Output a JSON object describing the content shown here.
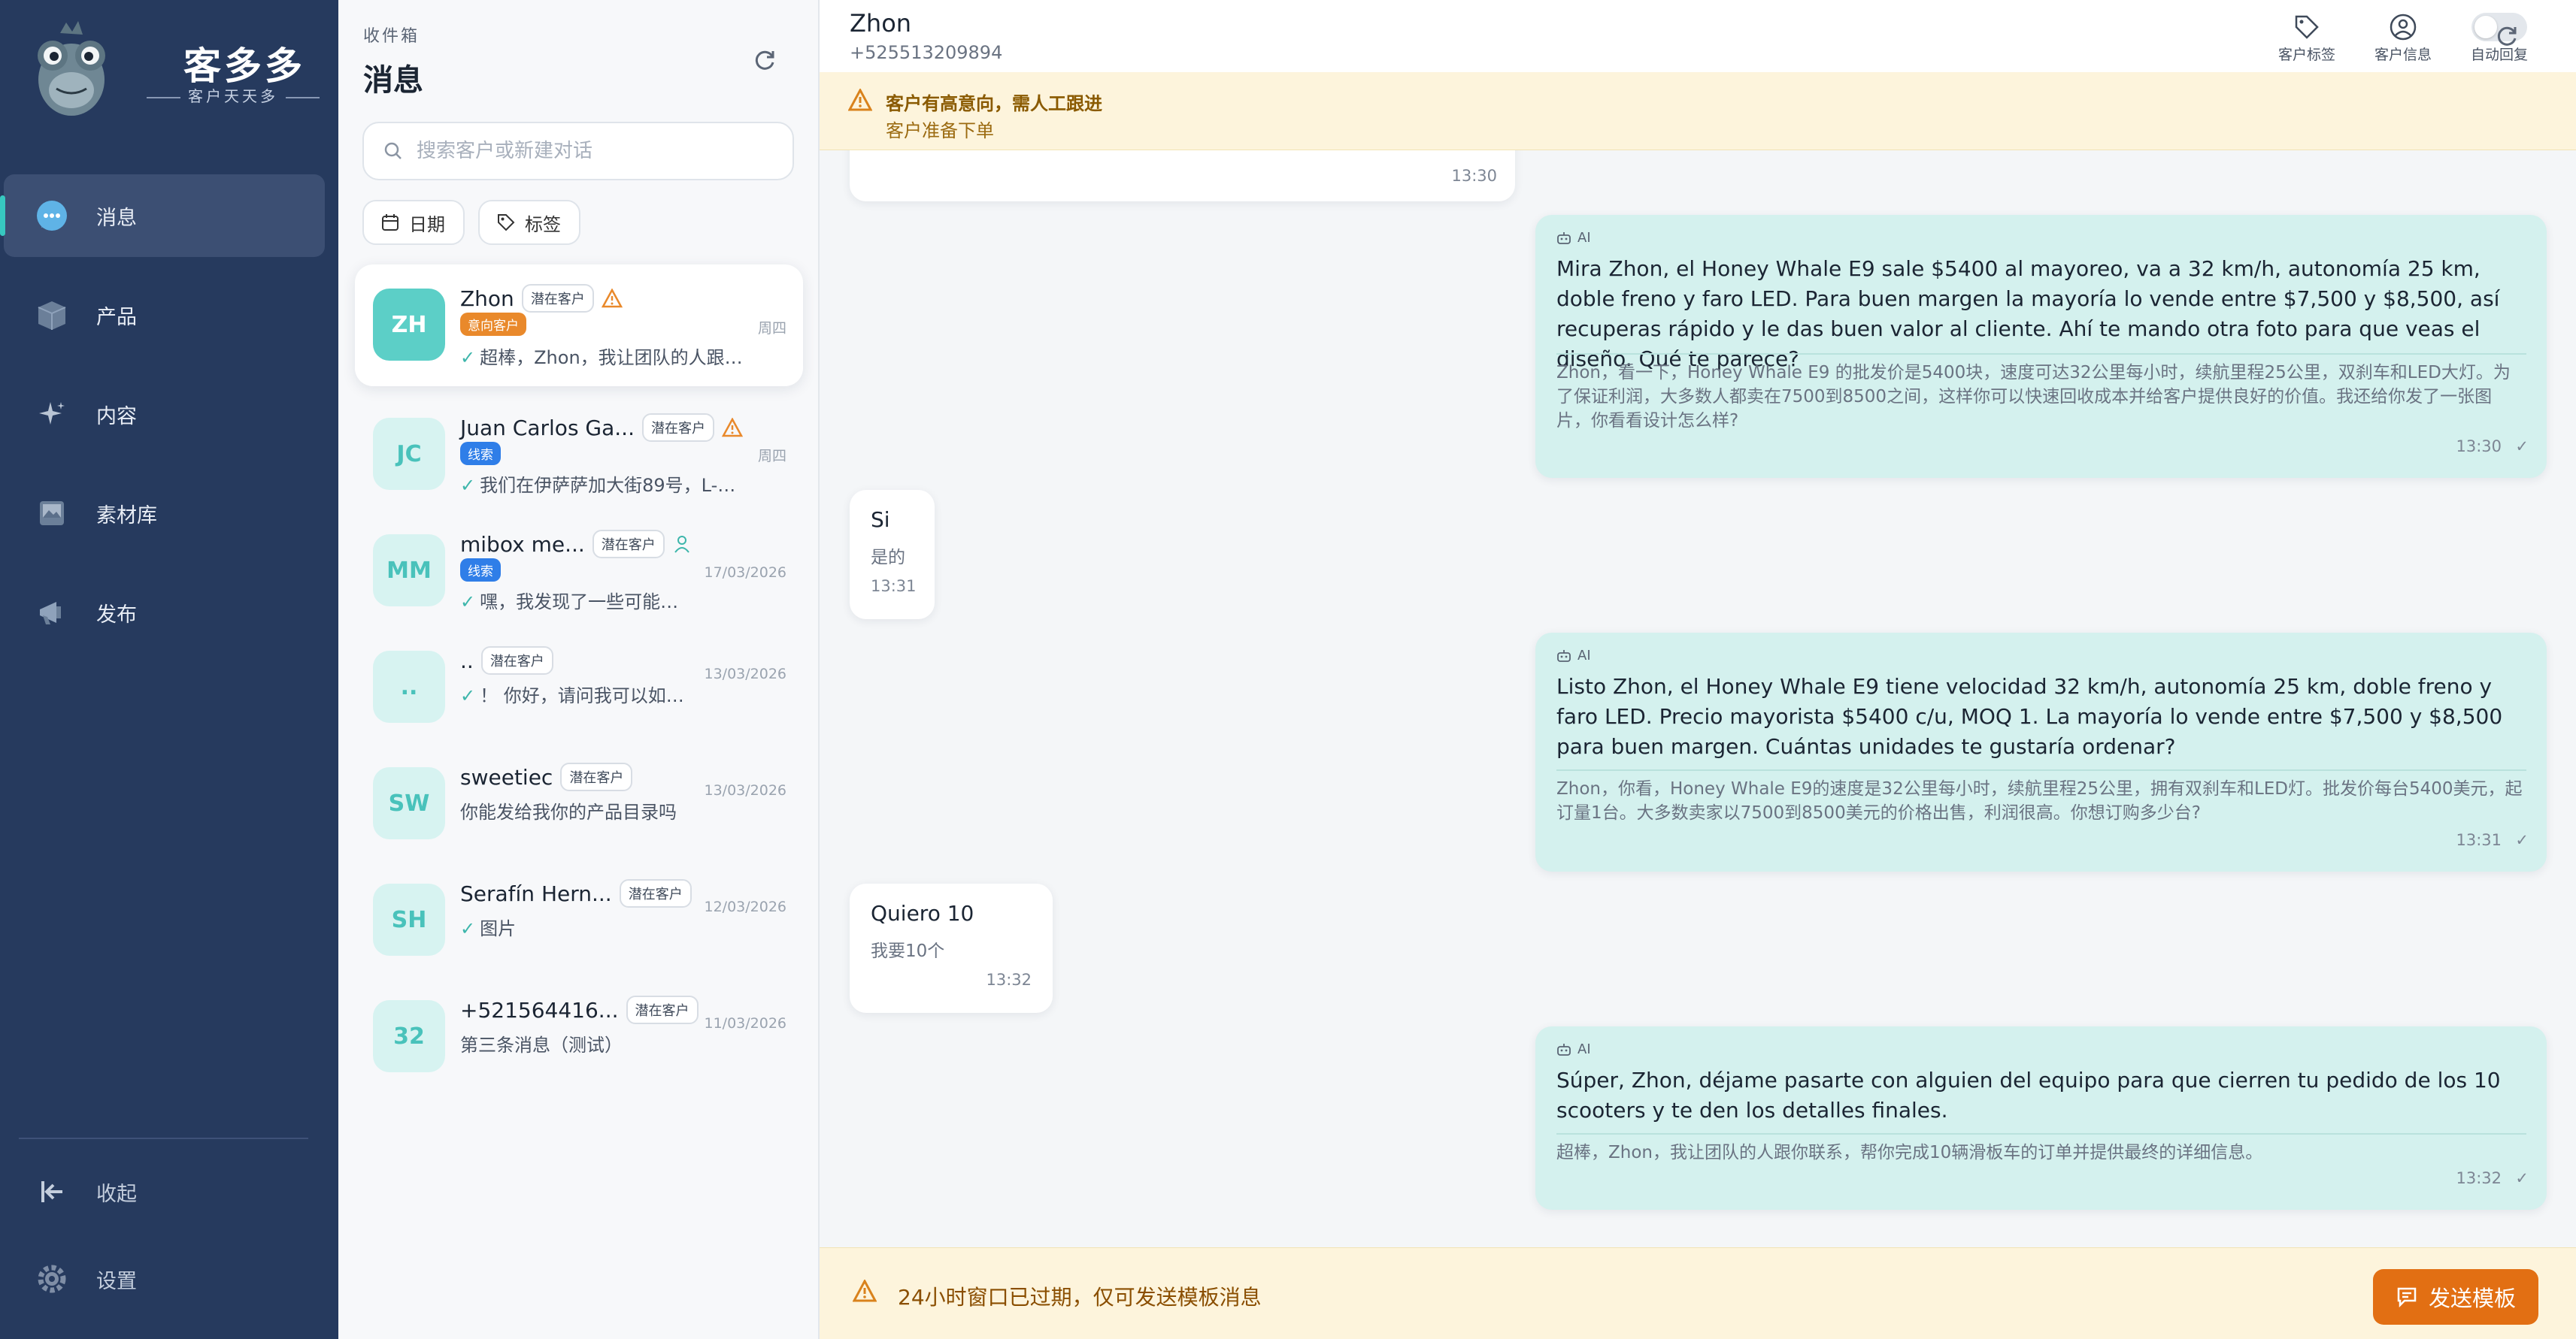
{
  "brand": {
    "name": "客多多",
    "tagline": "客户天天多"
  },
  "nav": {
    "items": [
      {
        "label": "消息",
        "icon": "chat-bubble-icon",
        "active": true
      },
      {
        "label": "产品",
        "icon": "box-icon",
        "active": false
      },
      {
        "label": "内容",
        "icon": "sparkle-icon",
        "active": false
      },
      {
        "label": "素材库",
        "icon": "image-library-icon",
        "active": false
      },
      {
        "label": "发布",
        "icon": "megaphone-icon",
        "active": false
      }
    ],
    "collapse_label": "收起",
    "settings_label": "设置"
  },
  "inbox": {
    "subtitle": "收件箱",
    "title": "消息",
    "search_placeholder": "搜索客户或新建对话",
    "filters": {
      "date": "日期",
      "tags": "标签"
    },
    "conversations": [
      {
        "initials": "ZH",
        "name": "Zhon",
        "tag": "潜在客户",
        "badge": "意向客户",
        "badge_color": "#e9892b",
        "preview": "超棒，Zhon，我让团队的人跟…",
        "date": "周四",
        "active": true
      },
      {
        "initials": "JC",
        "name": "Juan Carlos Ga...",
        "tag": "潜在客户",
        "badge": "线索",
        "badge_color": "#2f7ee8",
        "preview": "我们在伊萨萨加大街89号，L-…",
        "date": "周四"
      },
      {
        "initials": "MM",
        "name": "mibox me...",
        "tag": "潜在客户",
        "badge": "线索",
        "badge_color": "#2f7ee8",
        "preview": "嘿，我发现了一些可能…",
        "date": "17/03/2026"
      },
      {
        "initials": "..",
        "name": "..",
        "tag": "潜在客户",
        "preview": "！ 你好，请问我可以如…",
        "date": "13/03/2026"
      },
      {
        "initials": "SW",
        "name": "sweetiec",
        "tag": "潜在客户",
        "preview": "你能发给我你的产品目录吗",
        "date": "13/03/2026"
      },
      {
        "initials": "SH",
        "name": "Serafín Hern...",
        "tag": "潜在客户",
        "preview": "图片",
        "date": "12/03/2026"
      },
      {
        "initials": "32",
        "name": "+521564416...",
        "tag": "潜在客户",
        "preview": "第三条消息（测试）",
        "date": "11/03/2026"
      }
    ]
  },
  "chat": {
    "contact_name": "Zhon",
    "contact_phone": "+525513209894",
    "actions": {
      "tags": "客户标签",
      "info": "客户信息",
      "auto_reply": "自动回复"
    },
    "alert_title": "客户有高意向，需人工跟进",
    "alert_sub": "客户准备下单",
    "messages": [
      {
        "time": "13:30"
      },
      {
        "ai": "AI",
        "text": "Mira Zhon, el Honey Whale E9 sale $5400 al mayoreo, va a 32 km/h, autonomía 25 km, doble freno y faro LED. Para buen margen la mayoría lo vende entre $7,500 y $8,500, así recuperas rápido y le das buen valor al cliente. Ahí te mando otra foto para que veas el diseño. Qué te parece?",
        "translation": "Zhon，看一下，Honey Whale E9 的批发价是5400块，速度可达32公里每小时，续航里程25公里，双刹车和LED大灯。为了保证利润，大多数人都卖在7500到8500之间，这样你可以快速回收成本并给客户提供良好的价值。我还给你发了一张图片，你看看设计怎么样?",
        "time": "13:30"
      },
      {
        "text": "Si",
        "translation": "是的",
        "time": "13:31"
      },
      {
        "ai": "AI",
        "text": "Listo Zhon, el Honey Whale E9 tiene velocidad 32 km/h, autonomía 25 km, doble freno y faro LED. Precio mayorista $5400 c/u, MOQ 1. La mayoría lo vende entre $7,500 y $8,500 para buen margen. Cuántas unidades te gustaría ordenar?",
        "translation": "Zhon，你看，Honey Whale E9的速度是32公里每小时，续航里程25公里，拥有双刹车和LED灯。批发价每台5400美元，起订量1台。大多数卖家以7500到8500美元的价格出售，利润很高。你想订购多少台?",
        "time": "13:31"
      },
      {
        "text": "Quiero 10",
        "translation": "我要10个",
        "time": "13:32"
      },
      {
        "ai": "AI",
        "text": "Súper, Zhon, déjame pasarte con alguien del equipo para que cierren tu pedido de los 10 scooters y te den los detalles finales.",
        "translation": "超棒，Zhon，我让团队的人跟你联系，帮你完成10辆滑板车的订单并提供最终的详细信息。",
        "time": "13:32"
      }
    ],
    "footer_notice": "24小时窗口已过期，仅可发送模板消息",
    "send_template_label": "发送模板"
  },
  "colors": {
    "sidebar": "#263a5e",
    "accent": "#37c8c0",
    "out_bubble": "#d4f1ee",
    "warning": "#e26f13"
  }
}
